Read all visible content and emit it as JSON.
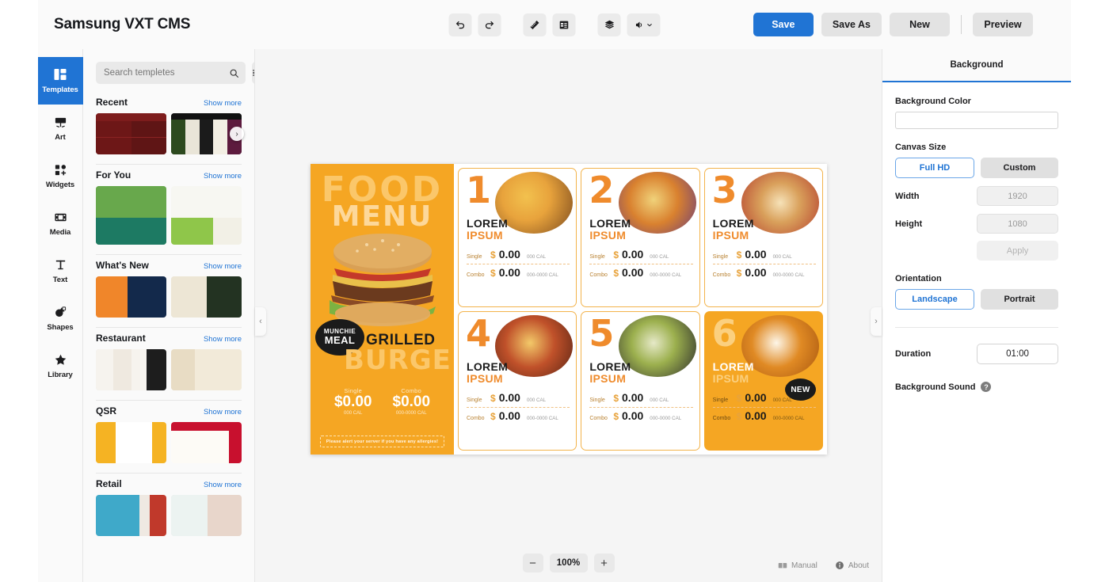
{
  "app": {
    "title": "Samsung VXT CMS"
  },
  "toolbar": {
    "icons": [
      {
        "name": "undo-icon",
        "glyph": "↶"
      },
      {
        "name": "redo-icon",
        "glyph": "↷"
      },
      {
        "name": "ruler-icon",
        "glyph": "📏"
      },
      {
        "name": "grid-panel-icon",
        "glyph": "▤"
      },
      {
        "name": "layers-icon",
        "glyph": "◈"
      },
      {
        "name": "volume-icon",
        "glyph": "🔊"
      }
    ],
    "save_label": "Save",
    "save_as_label": "Save As",
    "new_label": "New",
    "preview_label": "Preview"
  },
  "rail": {
    "items": [
      {
        "label": "Templates",
        "icon": "templates-icon",
        "active": true
      },
      {
        "label": "Art",
        "icon": "art-easel-icon",
        "active": false
      },
      {
        "label": "Widgets",
        "icon": "widgets-icon",
        "active": false
      },
      {
        "label": "Media",
        "icon": "media-film-icon",
        "active": false
      },
      {
        "label": "Text",
        "icon": "text-icon",
        "active": false
      },
      {
        "label": "Shapes",
        "icon": "shapes-icon",
        "active": false
      },
      {
        "label": "Library",
        "icon": "star-icon",
        "active": false
      }
    ]
  },
  "templates_panel": {
    "search_placeholder": "Search templetes",
    "search_value": "",
    "filter_icon": "filter-sliders-icon",
    "show_more_label": "Show more",
    "sections": [
      {
        "title": "Recent",
        "has_carousel": true
      },
      {
        "title": "For You",
        "has_carousel": false
      },
      {
        "title": "What's New",
        "has_carousel": false
      },
      {
        "title": "Restaurant",
        "has_carousel": false
      },
      {
        "title": "QSR",
        "has_carousel": false
      },
      {
        "title": "Retail",
        "has_carousel": false
      }
    ]
  },
  "canvas": {
    "collapse_left_glyph": "‹",
    "collapse_right_glyph": "›",
    "zoom": {
      "out_glyph": "−",
      "level": "100%",
      "in_glyph": "+"
    },
    "status": [
      {
        "label": "Manual",
        "icon": "manual-book-icon"
      },
      {
        "label": "About",
        "icon": "info-icon"
      }
    ],
    "design": {
      "hero": {
        "line1": "FOOD",
        "line2": "MENU",
        "badge_line1": "MUNCHIE",
        "badge_line2": "MEAL",
        "product_line1": "GRILLED",
        "product_line2": "BURGER",
        "prices": [
          {
            "label": "Single",
            "price": "$0.00",
            "cal": "000 CAL"
          },
          {
            "label": "Combo",
            "price": "$0.00",
            "cal": "000-0000 CAL"
          }
        ],
        "note": "Please alert your server if you have any allergies!"
      },
      "cards": [
        {
          "number": "1",
          "title1": "LOREM",
          "title2": "IPSUM",
          "single_label": "Single",
          "single_price": "$0.00",
          "single_cal": "000 CAL",
          "combo_label": "Combo",
          "combo_price": "$0.00",
          "combo_cal": "000-0000 CAL",
          "filled": false,
          "badge": ""
        },
        {
          "number": "2",
          "title1": "LOREM",
          "title2": "IPSUM",
          "single_label": "Single",
          "single_price": "$0.00",
          "single_cal": "000 CAL",
          "combo_label": "Combo",
          "combo_price": "$0.00",
          "combo_cal": "000-0000 CAL",
          "filled": false,
          "badge": ""
        },
        {
          "number": "3",
          "title1": "LOREM",
          "title2": "IPSUM",
          "single_label": "Single",
          "single_price": "$0.00",
          "single_cal": "000 CAL",
          "combo_label": "Combo",
          "combo_price": "$0.00",
          "combo_cal": "000-0000 CAL",
          "filled": false,
          "badge": ""
        },
        {
          "number": "4",
          "title1": "LOREM",
          "title2": "IPSUM",
          "single_label": "Single",
          "single_price": "$0.00",
          "single_cal": "000 CAL",
          "combo_label": "Combo",
          "combo_price": "$0.00",
          "combo_cal": "000-0000 CAL",
          "filled": false,
          "badge": ""
        },
        {
          "number": "5",
          "title1": "LOREM",
          "title2": "IPSUM",
          "single_label": "Single",
          "single_price": "$0.00",
          "single_cal": "000 CAL",
          "combo_label": "Combo",
          "combo_price": "$0.00",
          "combo_cal": "000-0000 CAL",
          "filled": false,
          "badge": ""
        },
        {
          "number": "6",
          "title1": "LOREM",
          "title2": "IPSUM",
          "single_label": "Single",
          "single_price": "$0.00",
          "single_cal": "000 CAL",
          "combo_label": "Combo",
          "combo_price": "$0.00",
          "combo_cal": "000-0000 CAL",
          "filled": true,
          "badge": "NEW"
        }
      ]
    }
  },
  "properties": {
    "tab_label": "Background",
    "background_color_label": "Background Color",
    "background_color_value": "#ffffff",
    "canvas_size_label": "Canvas Size",
    "size_full_hd": "Full HD",
    "size_custom": "Custom",
    "width_label": "Width",
    "width_value": "1920",
    "height_label": "Height",
    "height_value": "1080",
    "apply_label": "Apply",
    "orientation_label": "Orientation",
    "orientation_landscape": "Landscape",
    "orientation_portrait": "Portrait",
    "duration_label": "Duration",
    "duration_value": "01:00",
    "background_sound_label": "Background Sound",
    "help_glyph": "?"
  },
  "colors": {
    "accent": "#2074d4",
    "brand_orange": "#f5a623",
    "canvas_bg": "#f5f5f5"
  }
}
